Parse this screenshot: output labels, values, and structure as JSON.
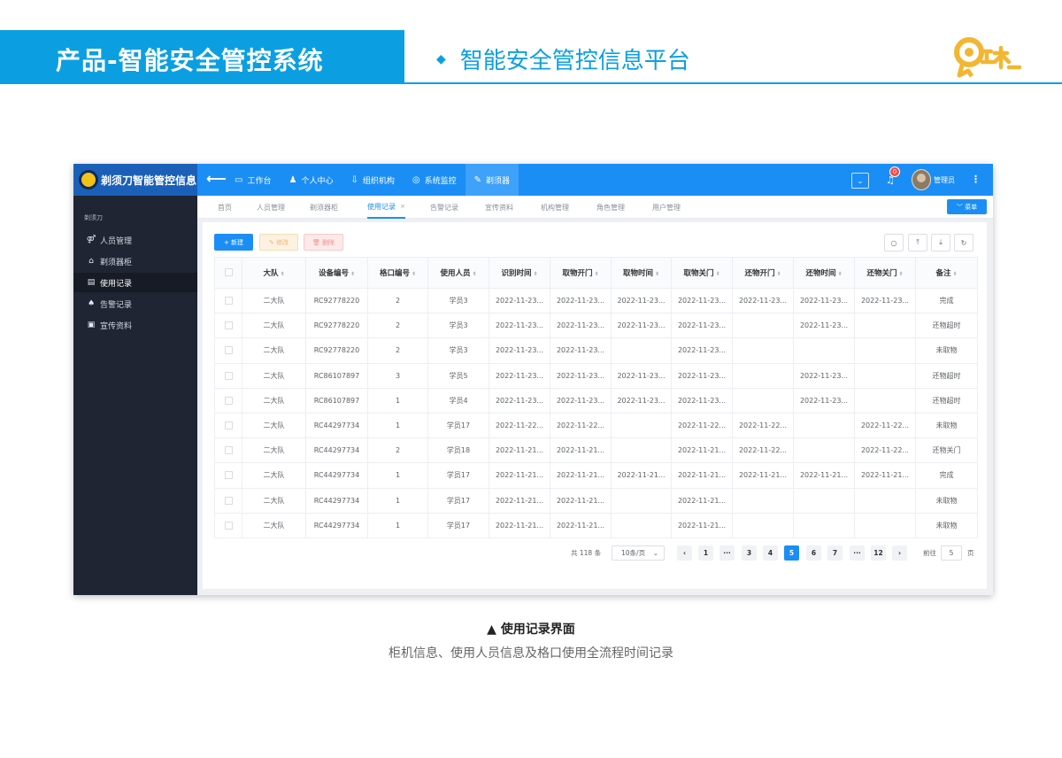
{
  "slide": {
    "title": "产品-智能安全管控系统",
    "subtitle": "智能安全管控信息平台",
    "bullet": "◆"
  },
  "colors": {
    "slide_accent": "#0b9fe2",
    "topbar": "#1b8ef5",
    "sidebar": "#1f2532",
    "active_page": "#1b8ef5"
  },
  "app": {
    "name": "剃须刀智能管控信息",
    "back_icon": "arrow-left-icon",
    "nav": [
      {
        "label": "工作台",
        "icon": "monitor-icon",
        "glyph": "▭"
      },
      {
        "label": "个人中心",
        "icon": "user-icon",
        "glyph": "♟"
      },
      {
        "label": "组织机构",
        "icon": "org-icon",
        "glyph": "⇩"
      },
      {
        "label": "系统监控",
        "icon": "monitor-eye-icon",
        "glyph": "◎"
      },
      {
        "label": "剃须器",
        "icon": "razor-icon",
        "glyph": "✎"
      }
    ],
    "notification_count": "0",
    "user_name": "管理员",
    "more_glyph": "⋮"
  },
  "sidebar": {
    "caption": "剃须刀",
    "items": [
      {
        "label": "人员管理",
        "icon": "users-icon",
        "glyph": "⚤"
      },
      {
        "label": "剃须器柜",
        "icon": "home-icon",
        "glyph": "⌂"
      },
      {
        "label": "使用记录",
        "icon": "list-icon",
        "glyph": "▤"
      },
      {
        "label": "告警记录",
        "icon": "bell-icon",
        "glyph": "♠"
      },
      {
        "label": "宣传资料",
        "icon": "image-icon",
        "glyph": "▣"
      }
    ]
  },
  "tabs": [
    {
      "label": "首页"
    },
    {
      "label": "人员管理"
    },
    {
      "label": "剃须器柜"
    },
    {
      "label": "使用记录",
      "close": "×"
    },
    {
      "label": "告警记录"
    },
    {
      "label": "宣传资料"
    },
    {
      "label": "机构管理"
    },
    {
      "label": "角色管理"
    },
    {
      "label": "用户管理"
    }
  ],
  "menu_button": "﹀ 菜单",
  "toolbar": {
    "new": "+ 新建",
    "edit": "✎ 修改",
    "delete": "🗑 删除",
    "tools": [
      {
        "icon": "search-icon",
        "glyph": "○"
      },
      {
        "icon": "upload-icon",
        "glyph": "⤒"
      },
      {
        "icon": "download-icon",
        "glyph": "⤓"
      },
      {
        "icon": "refresh-icon",
        "glyph": "↻"
      }
    ]
  },
  "table": {
    "sort_glyph": "⬍",
    "columns": [
      "大队",
      "设备编号",
      "格口编号",
      "使用人员",
      "识别时间",
      "取物开门",
      "取物时间",
      "取物关门",
      "还物开门",
      "还物时间",
      "还物关门",
      "备注"
    ],
    "rows": [
      [
        "二大队",
        "RC92778220",
        "2",
        "学员3",
        "2022-11-23...",
        "2022-11-23...",
        "2022-11-23...",
        "2022-11-23...",
        "2022-11-23...",
        "2022-11-23...",
        "2022-11-23...",
        "完成"
      ],
      [
        "二大队",
        "RC92778220",
        "2",
        "学员3",
        "2022-11-23...",
        "2022-11-23...",
        "2022-11-23...",
        "2022-11-23...",
        "",
        "2022-11-23...",
        "",
        "还物超时"
      ],
      [
        "二大队",
        "RC92778220",
        "2",
        "学员3",
        "2022-11-23...",
        "2022-11-23...",
        "",
        "2022-11-23...",
        "",
        "",
        "",
        "未取物"
      ],
      [
        "二大队",
        "RC86107897",
        "3",
        "学员5",
        "2022-11-23...",
        "2022-11-23...",
        "2022-11-23...",
        "2022-11-23...",
        "",
        "2022-11-23...",
        "",
        "还物超时"
      ],
      [
        "二大队",
        "RC86107897",
        "1",
        "学员4",
        "2022-11-23...",
        "2022-11-23...",
        "2022-11-23...",
        "2022-11-23...",
        "",
        "2022-11-23...",
        "",
        "还物超时"
      ],
      [
        "二大队",
        "RC44297734",
        "1",
        "学员17",
        "2022-11-22...",
        "2022-11-22...",
        "",
        "2022-11-22...",
        "2022-11-22...",
        "",
        "2022-11-22...",
        "未取物"
      ],
      [
        "二大队",
        "RC44297734",
        "2",
        "学员18",
        "2022-11-21...",
        "2022-11-21...",
        "",
        "2022-11-21...",
        "2022-11-22...",
        "",
        "2022-11-22...",
        "还物关门"
      ],
      [
        "二大队",
        "RC44297734",
        "1",
        "学员17",
        "2022-11-21...",
        "2022-11-21...",
        "2022-11-21...",
        "2022-11-21...",
        "2022-11-21...",
        "2022-11-21...",
        "2022-11-21...",
        "完成"
      ],
      [
        "二大队",
        "RC44297734",
        "1",
        "学员17",
        "2022-11-21...",
        "2022-11-21...",
        "",
        "2022-11-21...",
        "",
        "",
        "",
        "未取物"
      ],
      [
        "二大队",
        "RC44297734",
        "1",
        "学员17",
        "2022-11-21...",
        "2022-11-21...",
        "",
        "2022-11-21...",
        "",
        "",
        "",
        "未取物"
      ]
    ]
  },
  "pagination": {
    "total": "共 118 条",
    "page_size": "10条/页",
    "page_size_arrow": "⌄",
    "prev": "‹",
    "next": "›",
    "ellipsis": "···",
    "pages": [
      "1",
      "3",
      "4",
      "5",
      "6",
      "7",
      "12"
    ],
    "current": "5",
    "goto_prefix": "前往",
    "goto_value": "5",
    "goto_suffix": "页"
  },
  "caption": {
    "title": "▲  使用记录界面",
    "subtitle": "柜机信息、使用人员信息及格口使用全流程时间记录"
  }
}
